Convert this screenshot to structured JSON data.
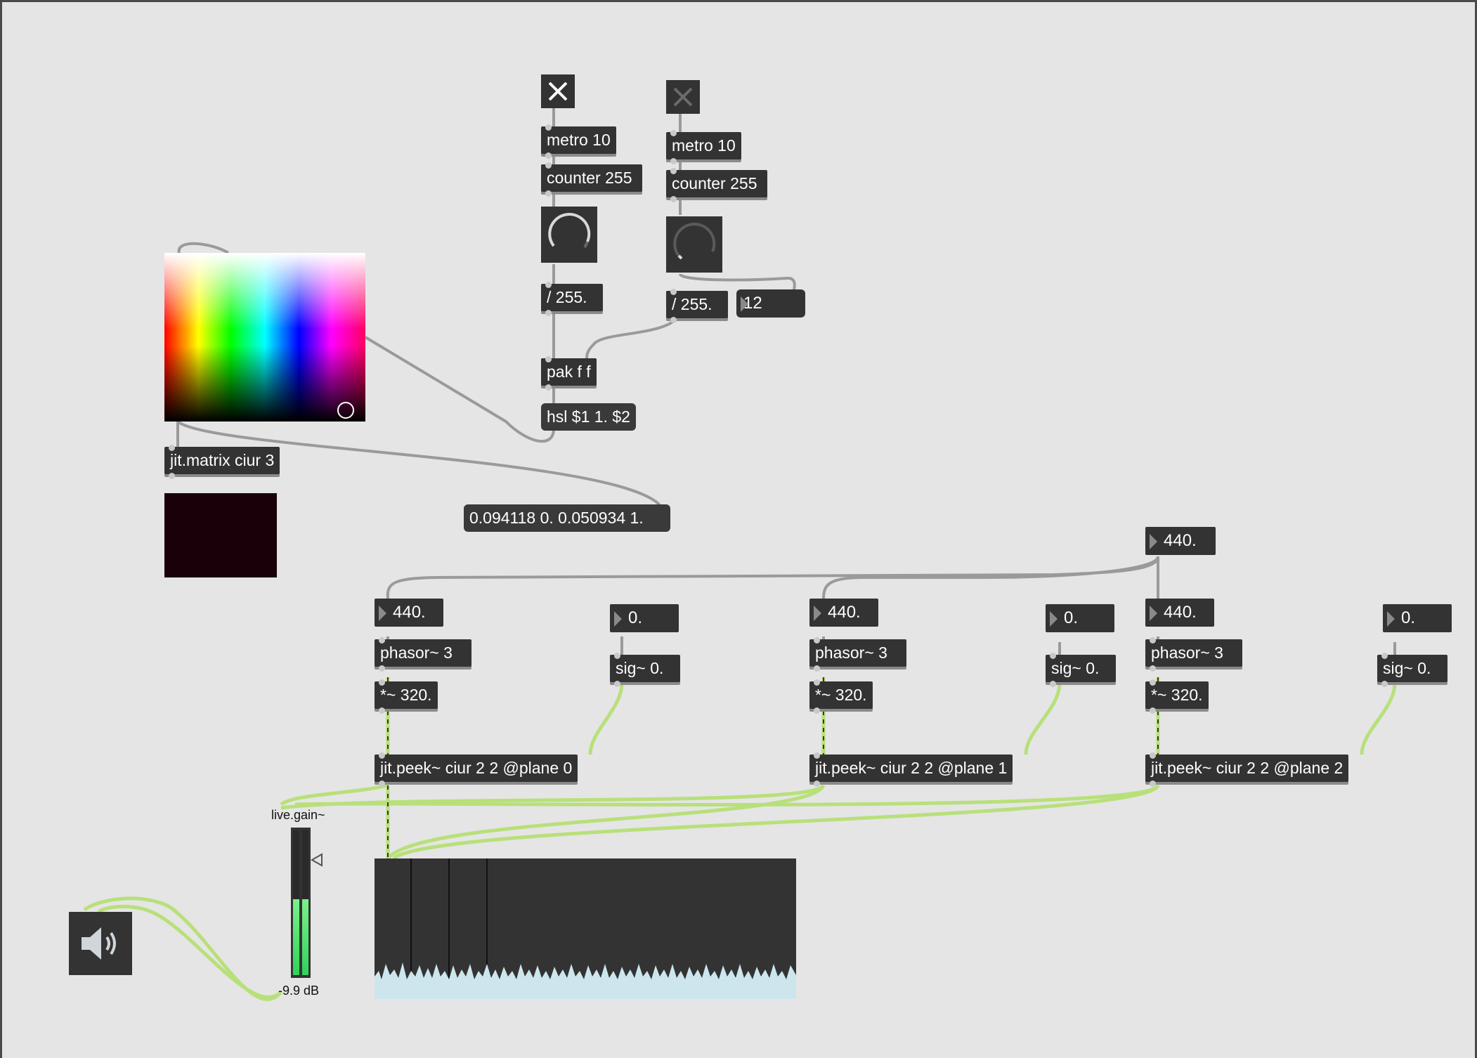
{
  "top_left_chain": {
    "metro": "metro 10",
    "counter": "counter 255",
    "div": "/ 255.",
    "pak": "pak f f",
    "hsl_msg": "hsl $1 1. $2"
  },
  "top_right_chain": {
    "metro": "metro 10",
    "counter": "counter 255",
    "div": "/ 255.",
    "number_value": "12"
  },
  "matrix": {
    "object": "jit.matrix ciur 3",
    "output_message": "0.094118 0. 0.050934 1."
  },
  "freq_master": "440.",
  "voices": [
    {
      "freq": "440.",
      "phasor": "phasor~ 3",
      "mult": "*~ 320.",
      "offset": "0.",
      "sig": "sig~ 0.",
      "peek": "jit.peek~ ciur 2 2 @plane 0"
    },
    {
      "freq": "440.",
      "phasor": "phasor~ 3",
      "mult": "*~ 320.",
      "offset": "0.",
      "sig": "sig~ 0.",
      "peek": "jit.peek~ ciur 2 2 @plane 1"
    },
    {
      "freq": "440.",
      "phasor": "phasor~ 3",
      "mult": "*~ 320.",
      "offset": "0.",
      "sig": "sig~ 0.",
      "peek": "jit.peek~ ciur 2 2 @plane 2"
    }
  ],
  "gain": {
    "label": "live.gain~",
    "value_text": "-9.9 dB"
  },
  "icons": {
    "toggle_on": "close-x-icon",
    "toggle_off": "close-x-icon",
    "speaker": "speaker-icon"
  },
  "colors": {
    "object_bg": "#333333",
    "canvas_bg": "#e5e5e5",
    "signal_cable": "#b8e07a",
    "meter_green": "#3ddc6a",
    "scope_wave": "#cde6ee"
  }
}
